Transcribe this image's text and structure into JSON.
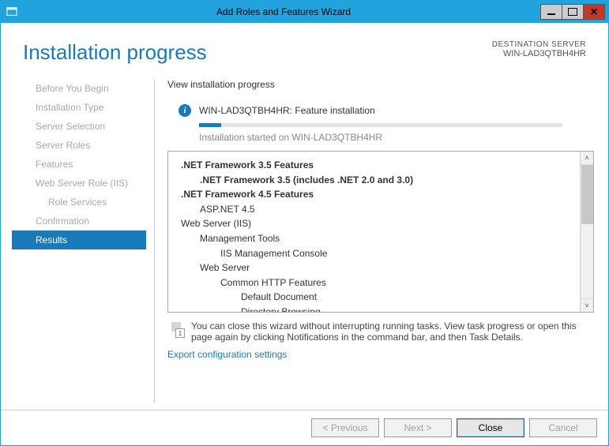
{
  "window": {
    "title": "Add Roles and Features Wizard"
  },
  "header": {
    "title": "Installation progress",
    "destination_label": "DESTINATION SERVER",
    "destination_server": "WIN-LAD3QTBH4HR"
  },
  "sidebar": {
    "items": [
      {
        "label": "Before You Begin",
        "active": false
      },
      {
        "label": "Installation Type",
        "active": false
      },
      {
        "label": "Server Selection",
        "active": false
      },
      {
        "label": "Server Roles",
        "active": false
      },
      {
        "label": "Features",
        "active": false
      },
      {
        "label": "Web Server Role (IIS)",
        "active": false
      },
      {
        "label": "Role Services",
        "active": false,
        "sub": true
      },
      {
        "label": "Confirmation",
        "active": false
      },
      {
        "label": "Results",
        "active": true
      }
    ]
  },
  "main": {
    "caption": "View installation progress",
    "status": "WIN-LAD3QTBH4HR: Feature installation",
    "progress_percent": 6,
    "substatus": "Installation started on WIN-LAD3QTBH4HR",
    "features": {
      "lines": [
        {
          "text": ".NET Framework 3.5 Features",
          "level": 1,
          "bold": true
        },
        {
          "text": ".NET Framework 3.5 (includes .NET 2.0 and 3.0)",
          "level": 2,
          "bold": true
        },
        {
          "text": ".NET Framework 4.5 Features",
          "level": 1,
          "bold": true
        },
        {
          "text": "ASP.NET 4.5",
          "level": 2,
          "bold": false
        },
        {
          "text": "Web Server (IIS)",
          "level": 1,
          "bold": false
        },
        {
          "text": "Management Tools",
          "level": 2,
          "bold": false
        },
        {
          "text": "IIS Management Console",
          "level": 3,
          "bold": false
        },
        {
          "text": "Web Server",
          "level": 2,
          "bold": false
        },
        {
          "text": "Common HTTP Features",
          "level": 3,
          "bold": false
        },
        {
          "text": "Default Document",
          "level": 4,
          "bold": false
        },
        {
          "text": "Directory Browsing",
          "level": 4,
          "bold": false
        }
      ]
    },
    "note": "You can close this wizard without interrupting running tasks. View task progress or open this page again by clicking Notifications in the command bar, and then Task Details.",
    "notification_badge": "1",
    "export_link": "Export configuration settings"
  },
  "footer": {
    "previous": "< Previous",
    "next": "Next >",
    "close": "Close",
    "cancel": "Cancel"
  }
}
